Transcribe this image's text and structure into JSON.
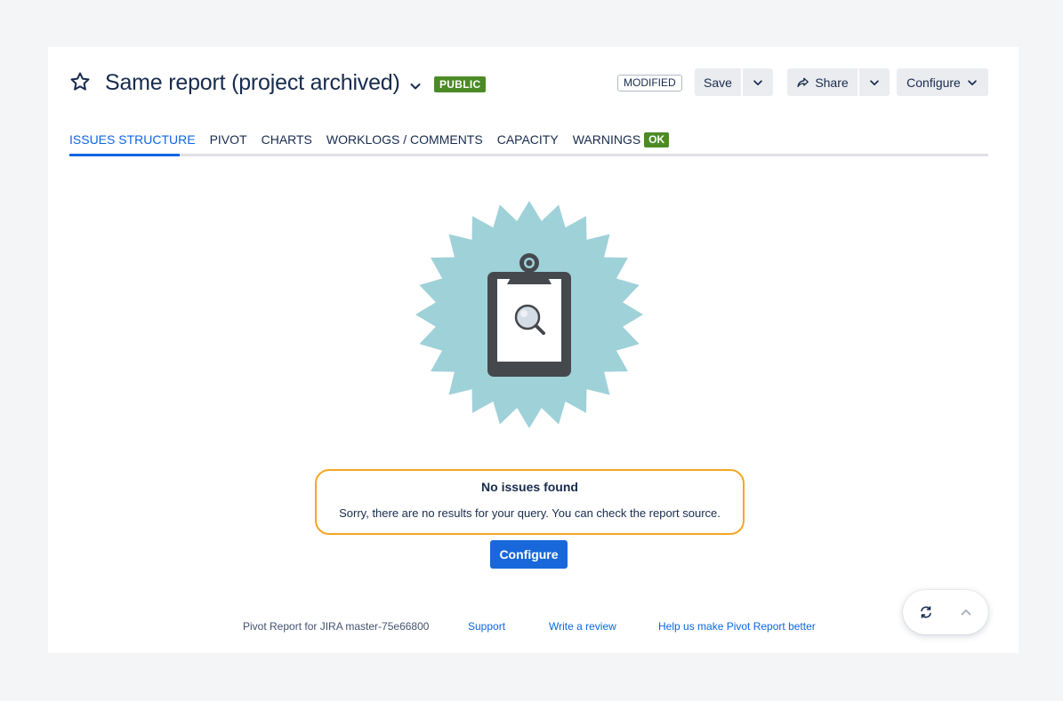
{
  "header": {
    "title": "Same report (project archived)",
    "visibility_badge": "PUBLIC",
    "status_badge": "MODIFIED",
    "save_label": "Save",
    "share_label": "Share",
    "configure_label": "Configure"
  },
  "tabs": [
    {
      "label": "ISSUES STRUCTURE",
      "active": true
    },
    {
      "label": "PIVOT",
      "active": false
    },
    {
      "label": "CHARTS",
      "active": false
    },
    {
      "label": "WORKLOGS / COMMENTS",
      "active": false
    },
    {
      "label": "CAPACITY",
      "active": false
    },
    {
      "label": "WARNINGS",
      "active": false,
      "badge": "OK"
    }
  ],
  "empty_state": {
    "title": "No issues found",
    "message": "Sorry, there are no results for your query. You can check the report source.",
    "button_label": "Configure"
  },
  "footer": {
    "version": "Pivot Report for JIRA master-75e66800",
    "support": "Support",
    "review": "Write a review",
    "help": "Help us make Pivot Report better"
  },
  "colors": {
    "accent": "#0c66e4",
    "primary_button": "#1868db",
    "ok_badge": "#4c8a26",
    "message_border": "#f5a623",
    "illustration_badge": "#9fd1d9",
    "clipboard": "#45494e"
  },
  "icons": {
    "star": "star-icon",
    "title_dropdown": "chevron-down-icon",
    "share": "share-icon",
    "refresh": "refresh-icon",
    "scroll_top": "chevron-up-icon"
  }
}
